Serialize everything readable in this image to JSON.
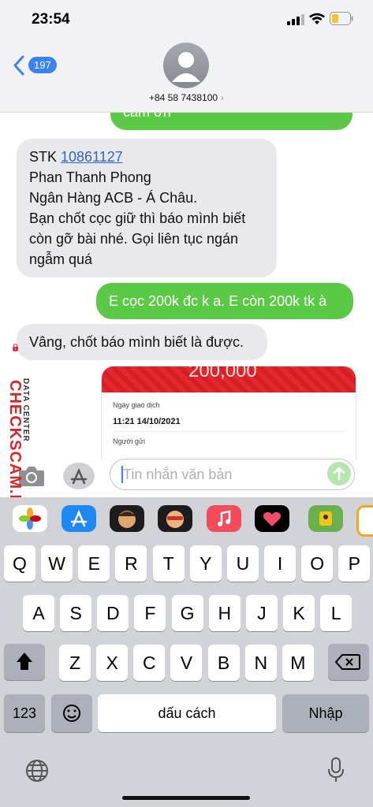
{
  "status_bar": {
    "time": "23:54"
  },
  "header": {
    "back_count": "197",
    "contact": "+84 58 7438100",
    "chevron": "›"
  },
  "messages": [
    {
      "type": "sent",
      "text": "cảm ơn"
    },
    {
      "type": "received",
      "lines": [
        "STK ",
        "10861127",
        "Phan Thanh Phong",
        "Ngân Hàng ACB - Á Châu.",
        "Bạn chốt cọc giữ thì báo mình biết",
        "còn gỡ bài nhé. Gọi liên tục ngán",
        "ngẫm quá"
      ]
    },
    {
      "type": "sent",
      "text": "E cọc 200k đc k a. E còn 200k tk à"
    },
    {
      "type": "received",
      "text": "Vâng, chốt báo mình biết là được."
    }
  ],
  "image_card": {
    "amount": "200,000",
    "label_date": "Ngày giao dịch",
    "value_date": "11:21 14/10/2021",
    "label_sender": "Người gửi"
  },
  "input": {
    "placeholder": "Tin nhắn văn bản"
  },
  "watermark": {
    "brand": "CHECKSCAM.INFO",
    "sub": "DATA CENTER"
  },
  "keyboard": {
    "row1": [
      "Q",
      "W",
      "E",
      "R",
      "T",
      "Y",
      "U",
      "I",
      "O",
      "P"
    ],
    "row2": [
      "A",
      "S",
      "D",
      "F",
      "G",
      "H",
      "J",
      "K",
      "L"
    ],
    "row3": [
      "Z",
      "X",
      "C",
      "V",
      "B",
      "N",
      "M"
    ],
    "numbers_key": "123",
    "space_key": "dấu cách",
    "return_key": "Nhập"
  },
  "icons": [
    "camera-icon",
    "app-store-icon",
    "send-icon",
    "globe-icon",
    "microphone-icon",
    "shift-icon",
    "backspace-icon",
    "emoji-icon",
    "photos-icon",
    "music-icon",
    "heart-icon",
    "memoji-icon"
  ]
}
